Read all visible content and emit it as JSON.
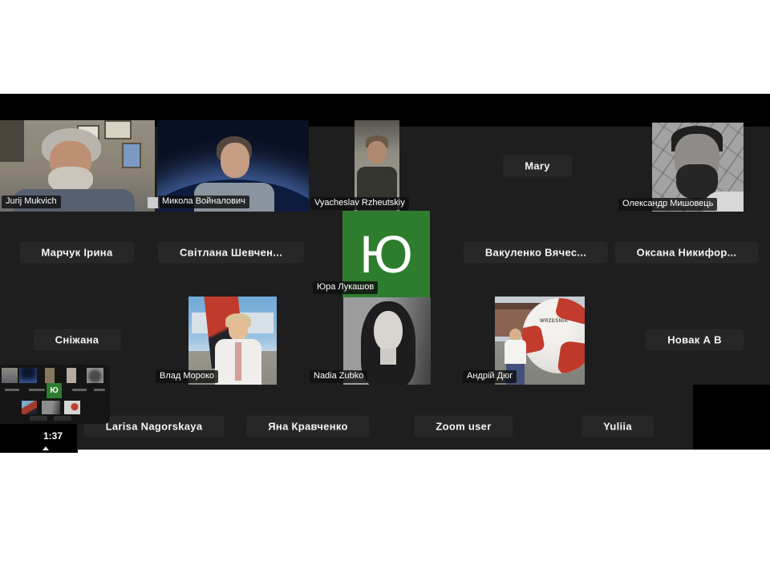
{
  "meeting": {
    "video_timestamp": "1:37",
    "colors": {
      "avatar_green": "#2e7d2e"
    },
    "tiles": {
      "row1": [
        {
          "name": "Jurij  Mukvich",
          "type": "video"
        },
        {
          "name": "Микола Войналович",
          "type": "video"
        },
        {
          "name": "Vyacheslav Rzheutskiy",
          "type": "video"
        },
        {
          "name": "Mary",
          "type": "name-only"
        },
        {
          "name": "Олександр Мишовець",
          "type": "video"
        }
      ],
      "row2": [
        {
          "name": "Марчук Ірина",
          "type": "name-only"
        },
        {
          "name": "Світлана  Шевчен...",
          "type": "name-only"
        },
        {
          "name": "Юра Лукашов",
          "type": "avatar",
          "avatar_letter": "Ю"
        },
        {
          "name": "Вакуленко  Вячес...",
          "type": "name-only"
        },
        {
          "name": "Оксана  Никифор...",
          "type": "name-only"
        }
      ],
      "row3": [
        {
          "name": "Сніжана",
          "type": "name-only"
        },
        {
          "name": "Влад Мороко",
          "type": "video"
        },
        {
          "name": "Nadia Zubko",
          "type": "video"
        },
        {
          "name": "Андрій Дюг",
          "type": "video",
          "ball_text": "WRZEŚNIA"
        },
        {
          "name": "Новак А В",
          "type": "name-only"
        }
      ],
      "row4": [
        {
          "name": "Larisa Nagorskaya",
          "type": "name-only"
        },
        {
          "name": "Яна Кравченко",
          "type": "name-only"
        },
        {
          "name": "Zoom user",
          "type": "name-only"
        },
        {
          "name": "Yuliia",
          "type": "name-only"
        }
      ]
    }
  }
}
